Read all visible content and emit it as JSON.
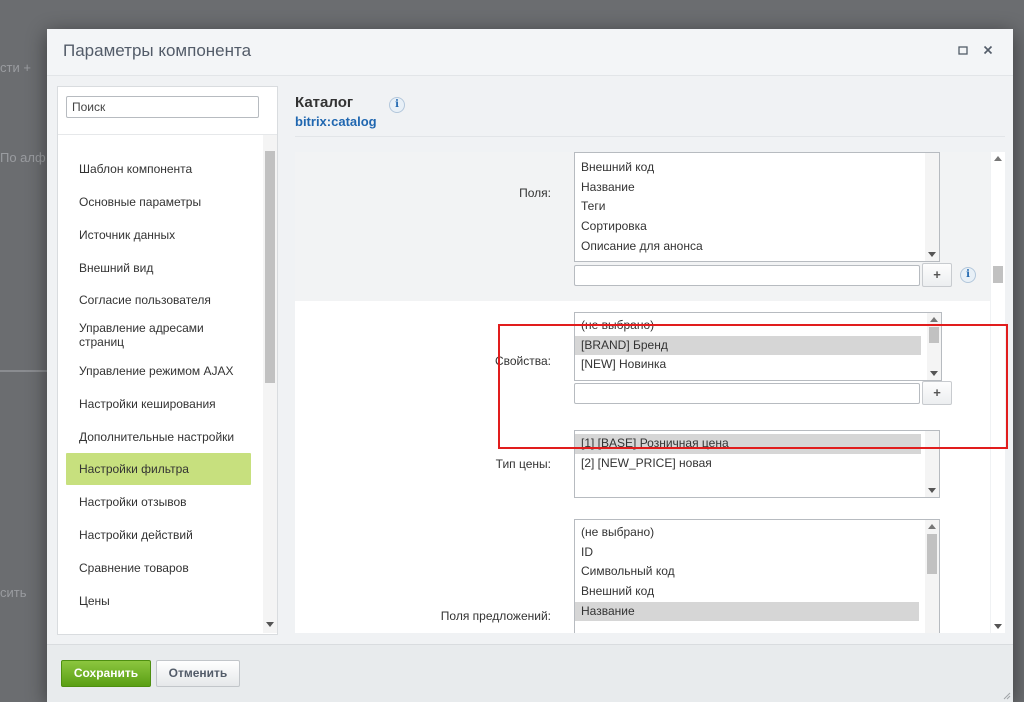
{
  "background": {
    "left_texts": [
      "сти +",
      "По алф",
      "сить"
    ]
  },
  "dialog": {
    "title": "Параметры компонента",
    "maximize_icon": "square-icon",
    "close_icon": "close-icon"
  },
  "sidebar": {
    "search_placeholder": "Поиск",
    "items": [
      {
        "label": "Шаблон компонента"
      },
      {
        "label": "Основные параметры"
      },
      {
        "label": "Источник данных"
      },
      {
        "label": "Внешний вид"
      },
      {
        "label": "Согласие пользователя"
      },
      {
        "label": "Управление адресами страниц"
      },
      {
        "label": "Управление режимом AJAX"
      },
      {
        "label": "Настройки кеширования"
      },
      {
        "label": "Дополнительные настройки"
      },
      {
        "label": "Настройки фильтра",
        "active": true
      },
      {
        "label": "Настройки отзывов"
      },
      {
        "label": "Настройки действий"
      },
      {
        "label": "Сравнение товаров"
      },
      {
        "label": "Цены"
      }
    ]
  },
  "header": {
    "title": "Каталог",
    "subtitle": "bitrix:catalog"
  },
  "fields": {
    "label": "Поля:",
    "options": [
      "Внешний код",
      "Название",
      "Теги",
      "Сортировка",
      "Описание для анонса"
    ]
  },
  "properties": {
    "label": "Свойства:",
    "options": [
      {
        "text": "(не выбрано)"
      },
      {
        "text": "[BRAND] Бренд",
        "selected": true
      },
      {
        "text": "[NEW] Новинка"
      }
    ]
  },
  "price_type": {
    "label": "Тип цены:",
    "options": [
      {
        "text": "[1] [BASE] Розничная цена",
        "selected": true
      },
      {
        "text": "[2] [NEW_PRICE] новая"
      }
    ]
  },
  "offer_fields": {
    "label": "Поля предложений:",
    "options": [
      {
        "text": "(не выбрано)"
      },
      {
        "text": "ID"
      },
      {
        "text": "Символьный код"
      },
      {
        "text": "Внешний код"
      },
      {
        "text": "Название",
        "selected": true
      }
    ]
  },
  "buttons": {
    "plus": "+",
    "info": "i",
    "save": "Сохранить",
    "cancel": "Отменить"
  },
  "colors": {
    "accent_green": "#8cc63f",
    "active_item": "#c7e07e",
    "link_blue": "#2067b0",
    "highlight_red": "#e11d1d"
  }
}
